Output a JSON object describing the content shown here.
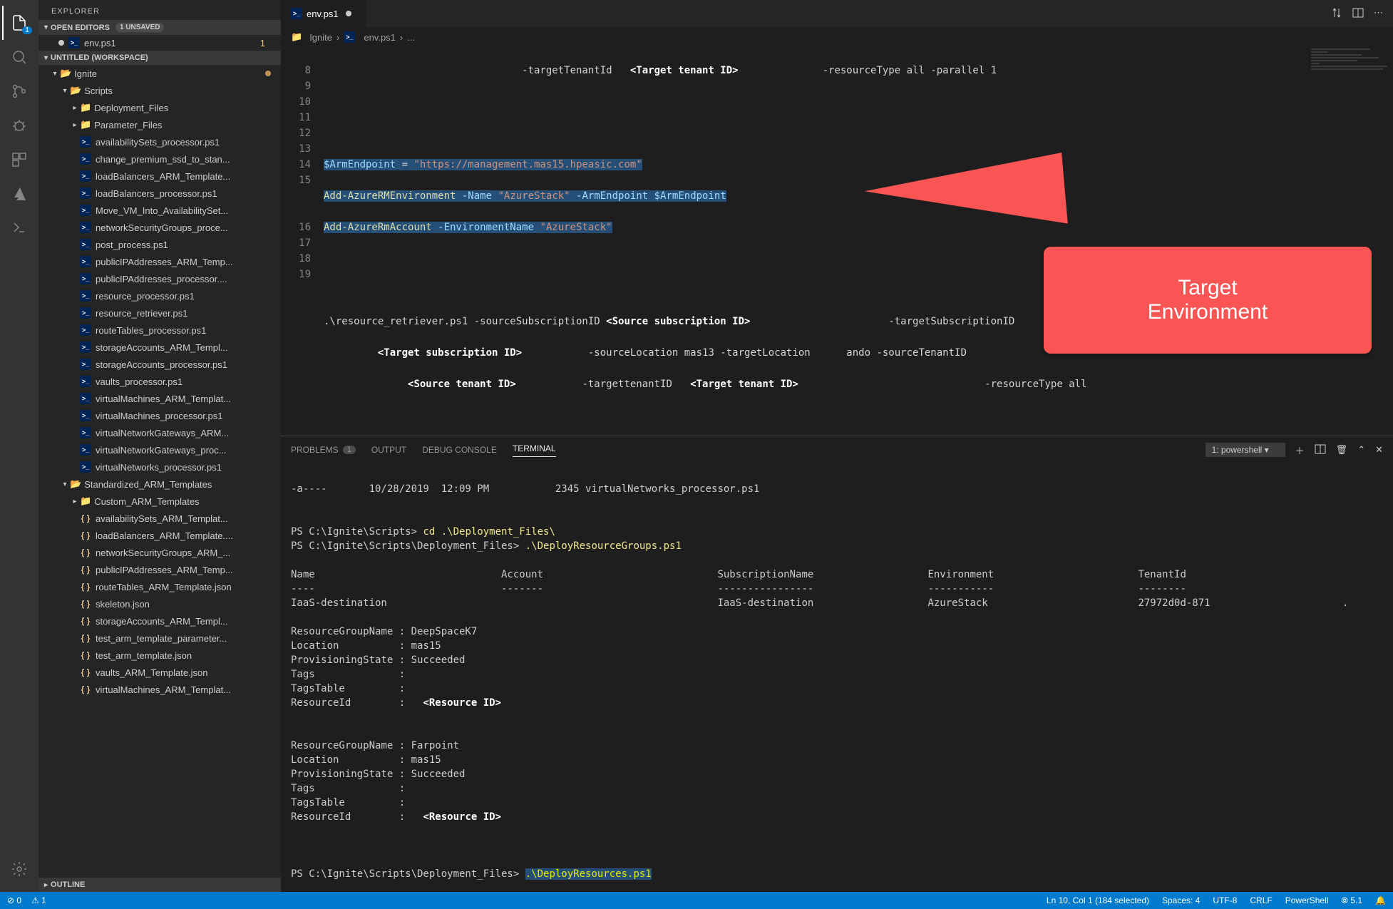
{
  "sidebar": {
    "title": "EXPLORER",
    "openEditors": {
      "label": "OPEN EDITORS",
      "unsaved": "1 UNSAVED",
      "items": [
        {
          "name": "env.ps1",
          "modCount": "1"
        }
      ]
    },
    "workspace": {
      "label": "UNTITLED (WORKSPACE)"
    },
    "tree": [
      {
        "depth": 0,
        "type": "folder-open",
        "name": "Ignite",
        "color": "green",
        "modDot": true
      },
      {
        "depth": 1,
        "type": "folder-open",
        "name": "Scripts"
      },
      {
        "depth": 2,
        "type": "folder",
        "name": "Deployment_Files"
      },
      {
        "depth": 2,
        "type": "folder",
        "name": "Parameter_Files"
      },
      {
        "depth": 2,
        "type": "ps",
        "name": "availabilitySets_processor.ps1"
      },
      {
        "depth": 2,
        "type": "ps",
        "name": "change_premium_ssd_to_stan..."
      },
      {
        "depth": 2,
        "type": "ps",
        "name": "loadBalancers_ARM_Template..."
      },
      {
        "depth": 2,
        "type": "ps",
        "name": "loadBalancers_processor.ps1"
      },
      {
        "depth": 2,
        "type": "ps",
        "name": "Move_VM_Into_AvailabilitySet..."
      },
      {
        "depth": 2,
        "type": "ps",
        "name": "networkSecurityGroups_proce..."
      },
      {
        "depth": 2,
        "type": "ps",
        "name": "post_process.ps1"
      },
      {
        "depth": 2,
        "type": "ps",
        "name": "publicIPAddresses_ARM_Temp..."
      },
      {
        "depth": 2,
        "type": "ps",
        "name": "publicIPAddresses_processor...."
      },
      {
        "depth": 2,
        "type": "ps",
        "name": "resource_processor.ps1"
      },
      {
        "depth": 2,
        "type": "ps",
        "name": "resource_retriever.ps1"
      },
      {
        "depth": 2,
        "type": "ps",
        "name": "routeTables_processor.ps1"
      },
      {
        "depth": 2,
        "type": "ps",
        "name": "storageAccounts_ARM_Templ..."
      },
      {
        "depth": 2,
        "type": "ps",
        "name": "storageAccounts_processor.ps1"
      },
      {
        "depth": 2,
        "type": "ps",
        "name": "vaults_processor.ps1"
      },
      {
        "depth": 2,
        "type": "ps",
        "name": "virtualMachines_ARM_Templat..."
      },
      {
        "depth": 2,
        "type": "ps",
        "name": "virtualMachines_processor.ps1"
      },
      {
        "depth": 2,
        "type": "ps",
        "name": "virtualNetworkGateways_ARM..."
      },
      {
        "depth": 2,
        "type": "ps",
        "name": "virtualNetworkGateways_proc..."
      },
      {
        "depth": 2,
        "type": "ps",
        "name": "virtualNetworks_processor.ps1"
      },
      {
        "depth": 1,
        "type": "folder-open",
        "name": "Standardized_ARM_Templates"
      },
      {
        "depth": 2,
        "type": "folder",
        "name": "Custom_ARM_Templates"
      },
      {
        "depth": 2,
        "type": "json",
        "name": "availabilitySets_ARM_Templat..."
      },
      {
        "depth": 2,
        "type": "json",
        "name": "loadBalancers_ARM_Template...."
      },
      {
        "depth": 2,
        "type": "json",
        "name": "networkSecurityGroups_ARM_..."
      },
      {
        "depth": 2,
        "type": "json",
        "name": "publicIPAddresses_ARM_Temp..."
      },
      {
        "depth": 2,
        "type": "json",
        "name": "routeTables_ARM_Template.json"
      },
      {
        "depth": 2,
        "type": "json",
        "name": "skeleton.json"
      },
      {
        "depth": 2,
        "type": "json",
        "name": "storageAccounts_ARM_Templ..."
      },
      {
        "depth": 2,
        "type": "json",
        "name": "test_arm_template_parameter..."
      },
      {
        "depth": 2,
        "type": "json",
        "name": "test_arm_template.json"
      },
      {
        "depth": 2,
        "type": "json",
        "name": "vaults_ARM_Template.json"
      },
      {
        "depth": 2,
        "type": "json",
        "name": "virtualMachines_ARM_Templat..."
      }
    ],
    "outline": "OUTLINE"
  },
  "tabs": {
    "file": "env.ps1"
  },
  "breadcrumb": {
    "p0": "Ignite",
    "p1": "env.ps1",
    "p2": "..."
  },
  "editor": {
    "lineNumbers": [
      "8",
      "9",
      "10",
      "11",
      "12",
      "13",
      "14",
      "15",
      "",
      "",
      "16",
      "17",
      "18",
      "19"
    ],
    "pre": {
      "l0a": "                                 -targetTenantId   ",
      "l0b": "<Target tenant ID>",
      "l0c": "              -resourceType all -parallel 1",
      "l10a": "$ArmEndpoint",
      "l10b": " = ",
      "l10c": "\"https://management.mas15.hpeasic.com\"",
      "l11a": "Add-AzureRMEnvironment",
      "l11sp": " ",
      "l11b": "-Name",
      "l11c": " \"AzureStack\"",
      "l11d": " -ArmEndpoint",
      "l11e": " $ArmEndpoint",
      "l12a": "Add-AzureRmAccount",
      "l12b": " -EnvironmentName",
      "l12c": " \"AzureStack\"",
      "l15a": ".\\resource_retriever.ps1 -sourceSubscriptionID ",
      "l15b": "<Source subscription ID>",
      "l15c": "                       -targetSubscriptionID",
      "l15d": "         ",
      "l15e": "<Target subscription ID>",
      "l15f": "           -sourceLocation mas13 -targetLocation      ando -sourceTenantID",
      "l15g": "              ",
      "l15h": "<Source tenant ID>",
      "l15i": "           -targettenantID   ",
      "l15j": "<Target tenant ID>",
      "l15k": "                               -resourceType all"
    }
  },
  "callout": "Target\nEnvironment",
  "panel": {
    "tabs": {
      "problems": "PROBLEMS",
      "problemsCount": "1",
      "output": "OUTPUT",
      "debug": "DEBUG CONSOLE",
      "terminal": "TERMINAL"
    },
    "terminalSelect": "1: powershell",
    "lines": {
      "l0": "-a----       10/28/2019  12:09 PM           2345 virtualNetworks_processor.ps1",
      "l1": "",
      "l2": "",
      "p1a": "PS C:\\Ignite\\Scripts> ",
      "p1b": "cd .\\Deployment_Files\\",
      "p2a": "PS C:\\Ignite\\Scripts\\Deployment_Files> ",
      "p2b": ".\\DeployResourceGroups.ps1",
      "hdr": "Name                               Account                             SubscriptionName                   Environment                        TenantId",
      "sep": "----                               -------                             ----------------                   -----------                        --------",
      "row": "IaaS-destination                                                       IaaS-destination                   AzureStack                         27972d0d-871                      .",
      "rg1a": "ResourceGroupName : DeepSpaceK7",
      "rg1b": "Location          : mas15",
      "rg1c": "ProvisioningState : Succeeded",
      "rg1d": "Tags              :",
      "rg1e": "TagsTable         :",
      "rg1f": "ResourceId        :   ",
      "rg1fph": "<Resource ID>",
      "rg2a": "ResourceGroupName : Farpoint",
      "rg2b": "Location          : mas15",
      "rg2c": "ProvisioningState : Succeeded",
      "rg2d": "Tags              :",
      "rg2e": "TagsTable         :",
      "rg2f": "ResourceId        :   ",
      "rg2fph": "<Resource ID>",
      "p3a": "PS C:\\Ignite\\Scripts\\Deployment_Files> ",
      "p3b": ".\\DeployResources.ps1"
    }
  },
  "status": {
    "errors": "⊘ 0",
    "warnings": "⚠ 1",
    "cursor": "Ln 10, Col 1 (184 selected)",
    "spaces": "Spaces: 4",
    "encoding": "UTF-8",
    "eol": "CRLF",
    "lang": "PowerShell",
    "ext": "⦾ 5.1",
    "bell": "🔔"
  }
}
